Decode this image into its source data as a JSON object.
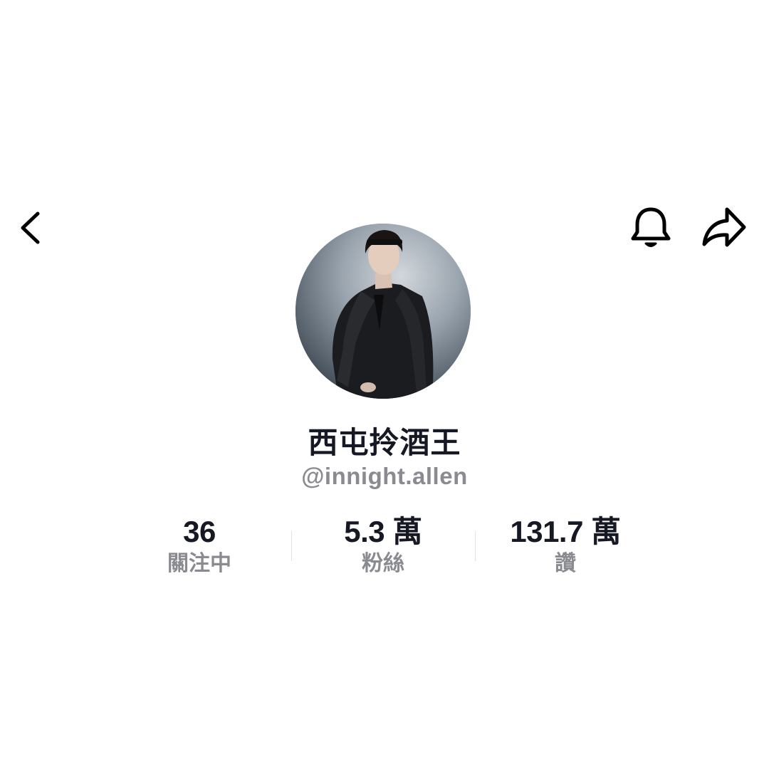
{
  "topbar": {
    "back_icon": "chevron-left-icon",
    "notification_icon": "bell-icon",
    "share_icon": "share-arrow-icon"
  },
  "profile": {
    "display_name": "西屯拎酒王",
    "handle": "@innight.allen",
    "avatar": "profile-photo"
  },
  "stats": [
    {
      "value": "36",
      "label": "關注中"
    },
    {
      "value": "5.3 萬",
      "label": "粉絲"
    },
    {
      "value": "131.7 萬",
      "label": "讚"
    }
  ],
  "colors": {
    "primary_text": "#161823",
    "secondary_text": "#8a8b91",
    "background": "#ffffff",
    "divider": "#e3e3e4"
  }
}
